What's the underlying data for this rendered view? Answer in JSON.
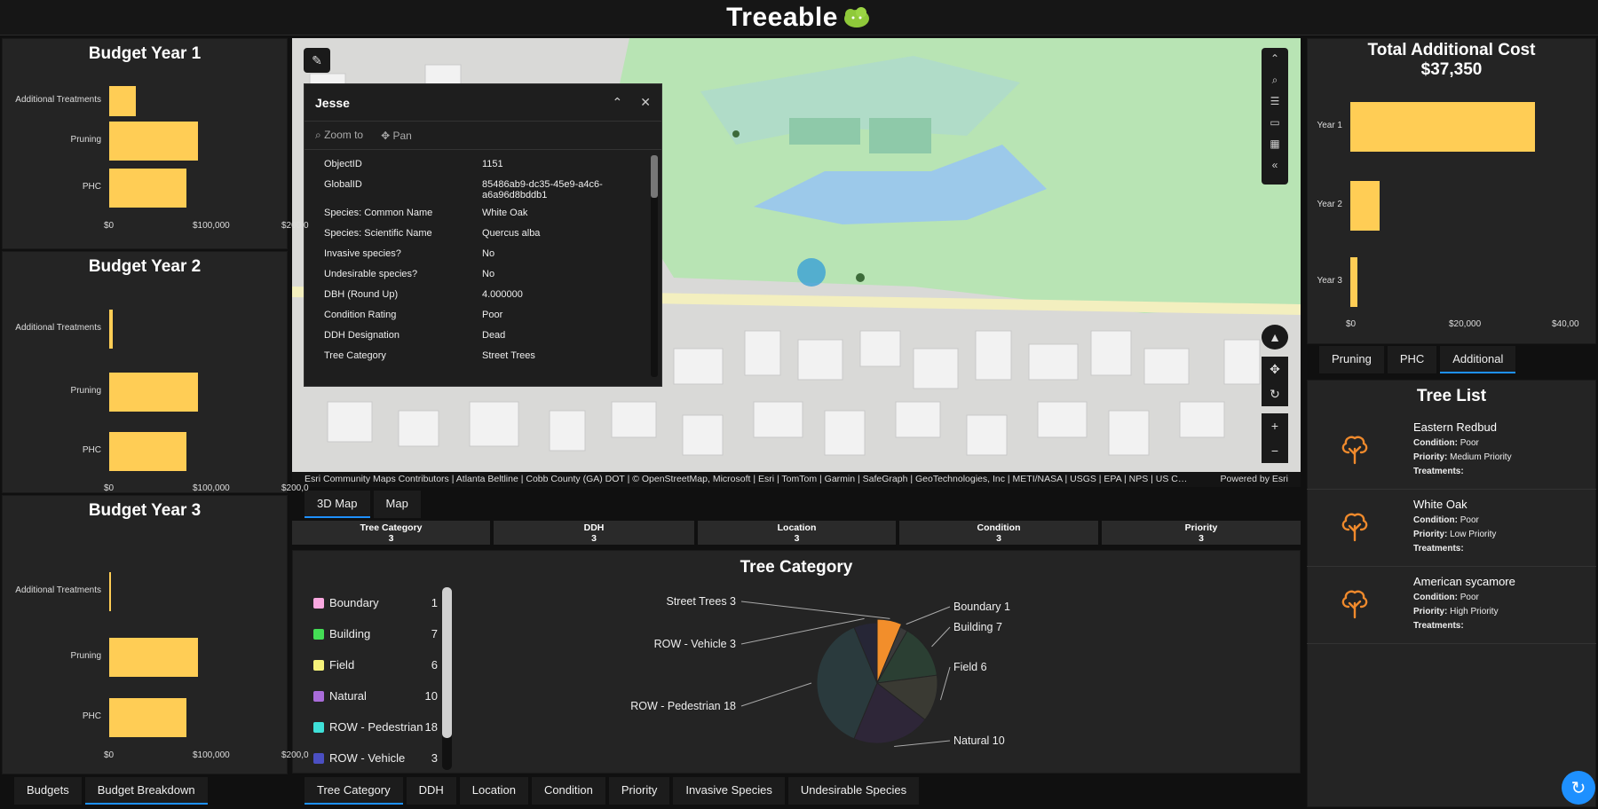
{
  "app": {
    "title_part1": "Tree",
    "title_part2": "able"
  },
  "budgets": [
    {
      "title": "Budget Year 1",
      "chart": {
        "type": "bar",
        "orientation": "horizontal",
        "categories": [
          "Additional Treatments",
          "Pruning",
          "PHC"
        ],
        "values": [
          30000,
          100000,
          87000
        ],
        "xlim": [
          0,
          200000
        ],
        "ticks": [
          "$0",
          "$100,000",
          "$200,0"
        ]
      }
    },
    {
      "title": "Budget Year 2",
      "chart": {
        "type": "bar",
        "orientation": "horizontal",
        "categories": [
          "Additional Treatments",
          "Pruning",
          "PHC"
        ],
        "values": [
          4000,
          100000,
          87000
        ],
        "xlim": [
          0,
          200000
        ],
        "ticks": [
          "$0",
          "$100,000",
          "$200,0"
        ]
      }
    },
    {
      "title": "Budget Year 3",
      "chart": {
        "type": "bar",
        "orientation": "horizontal",
        "categories": [
          "Additional Treatments",
          "Pruning",
          "PHC"
        ],
        "values": [
          1500,
          100000,
          87000
        ],
        "xlim": [
          0,
          200000
        ],
        "ticks": [
          "$0",
          "$100,000",
          "$200,0"
        ]
      }
    }
  ],
  "left_tabs": [
    "Budgets",
    "Budget Breakdown"
  ],
  "popup": {
    "title": "Jesse",
    "zoom": "Zoom to",
    "pan": "Pan",
    "fields": [
      {
        "k": "ObjectID",
        "v": "1151"
      },
      {
        "k": "GlobalID",
        "v": "85486ab9-dc35-45e9-a4c6-a6a96d8bddb1"
      },
      {
        "k": "Species: Common Name",
        "v": "White Oak"
      },
      {
        "k": "Species: Scientific Name",
        "v": "Quercus alba"
      },
      {
        "k": "Invasive species?",
        "v": "No"
      },
      {
        "k": "Undesirable species?",
        "v": "No"
      },
      {
        "k": "DBH (Round Up)",
        "v": "4.000000"
      },
      {
        "k": "Condition Rating",
        "v": "Poor"
      },
      {
        "k": "DDH Designation",
        "v": "Dead"
      },
      {
        "k": "Tree Category",
        "v": "Street Trees"
      }
    ]
  },
  "map": {
    "attribution": "Esri Community Maps Contributors | Atlanta Beltline | Cobb County (GA) DOT | © OpenStreetMap, Microsoft | Esri | TomTom | Garmin | SafeGraph | GeoTechnologies, Inc | METI/NASA | USGS | EPA | NPS | US Census ...",
    "powered": "Powered by Esri",
    "tabs": [
      "3D Map",
      "Map"
    ]
  },
  "filters": [
    {
      "label": "Tree Category",
      "count": "3"
    },
    {
      "label": "DDH",
      "count": "3"
    },
    {
      "label": "Location",
      "count": "3"
    },
    {
      "label": "Condition",
      "count": "3"
    },
    {
      "label": "Priority",
      "count": "3"
    }
  ],
  "tree_category": {
    "title": "Tree Category",
    "legend": [
      {
        "name": "Boundary",
        "value": "1",
        "color": "#f9a8e0"
      },
      {
        "name": "Building",
        "value": "7",
        "color": "#44dd55"
      },
      {
        "name": "Field",
        "value": "6",
        "color": "#f5f27a"
      },
      {
        "name": "Natural",
        "value": "10",
        "color": "#a96cd9"
      },
      {
        "name": "ROW - Pedestrian",
        "value": "18",
        "color": "#3fe0d8"
      },
      {
        "name": "ROW - Vehicle",
        "value": "3",
        "color": "#4b4fc2"
      }
    ]
  },
  "chart_data": {
    "type": "pie",
    "title": "Tree Category",
    "categories": [
      "Street Trees",
      "Boundary",
      "Building",
      "Field",
      "Natural",
      "ROW - Pedestrian",
      "ROW - Vehicle"
    ],
    "values": [
      3,
      1,
      7,
      6,
      10,
      18,
      3
    ],
    "labels": [
      "Street Trees 3",
      "Boundary 1",
      "Building 7",
      "Field 6",
      "Natural 10",
      "ROW - Pedestrian 18",
      "ROW - Vehicle 3"
    ],
    "colors": [
      "#f28e2b",
      "#3a3a3a",
      "#2b3f33",
      "#3a3a33",
      "#2e2638",
      "#2a3a3d",
      "#262636"
    ]
  },
  "bottom_tabs": [
    "Tree Category",
    "DDH",
    "Location",
    "Condition",
    "Priority",
    "Invasive Species",
    "Undesirable Species"
  ],
  "additional": {
    "title_line1": "Total Additional Cost",
    "title_line2": "$37,350",
    "chart": {
      "type": "bar",
      "orientation": "horizontal",
      "categories": [
        "Year 1",
        "Year 2",
        "Year 3"
      ],
      "values": [
        32000,
        5000,
        1200
      ],
      "xlim": [
        0,
        40000
      ],
      "ticks": [
        "$0",
        "$20,000",
        "$40,00"
      ]
    },
    "tabs": [
      "Pruning",
      "PHC",
      "Additional"
    ]
  },
  "tree_list": {
    "title": "Tree List",
    "condition_label": "Condition:",
    "priority_label": "Priority:",
    "treatments_label": "Treatments:",
    "items": [
      {
        "name": "Eastern Redbud",
        "condition": "Poor",
        "priority": "Medium Priority"
      },
      {
        "name": "White Oak",
        "condition": "Poor",
        "priority": "Low Priority"
      },
      {
        "name": "American sycamore",
        "condition": "Poor",
        "priority": "High Priority"
      }
    ]
  },
  "colors": {
    "bar": "#ffcd55",
    "accent": "#1e90ff",
    "tree_icon": "#f08a2c",
    "logo_green": "#8fc93a"
  },
  "icons": [
    "pencil-icon",
    "collapse-icon",
    "close-icon",
    "zoom-icon",
    "pan-icon",
    "search-icon",
    "list-icon",
    "compass-icon",
    "zoom-in-icon",
    "zoom-out-icon",
    "tree-icon",
    "refresh-icon"
  ]
}
